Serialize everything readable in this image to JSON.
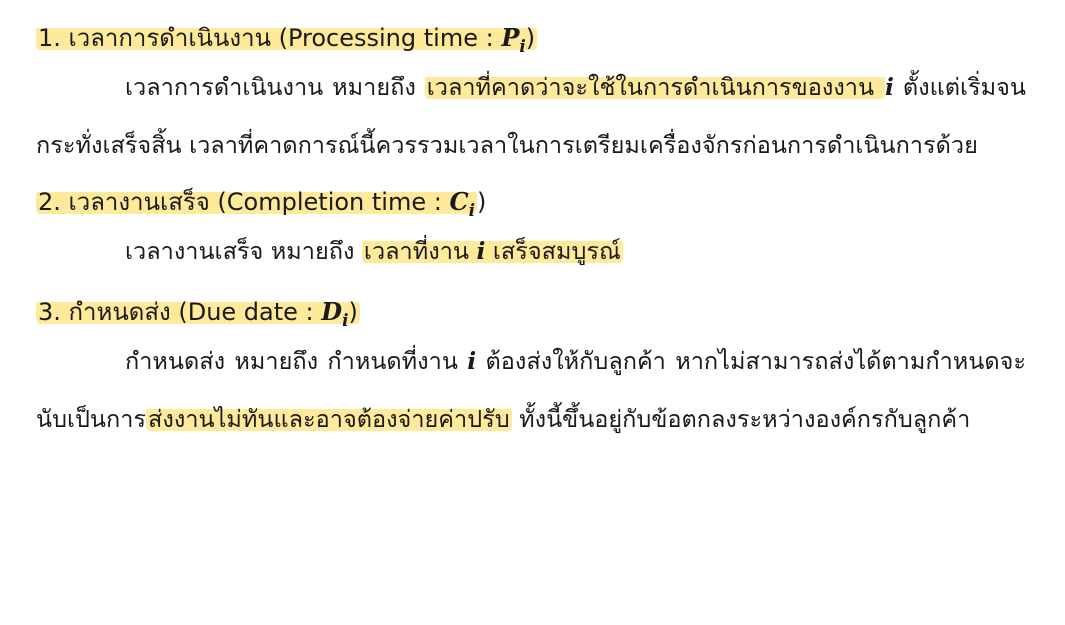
{
  "sections": [
    {
      "heading": {
        "prefix": "1. เวลาการดำเนินงาน (Processing time : ",
        "var": "P",
        "sub": "i",
        "suffix": ")"
      },
      "body": {
        "t1": "เวลาการดำเนินงาน หมายถึง ",
        "hl1": "เวลาที่คาดว่าจะใช้ในการดำเนินการของงาน ",
        "var": "i",
        "t2": " ตั้งแต่เริ่มจนกระทั่งเสร็จสิ้น เวลาที่คาดการณ์นี้ควรรวมเวลาในการเตรียมเครื่องจักรก่อนการดำเนินการด้วย"
      }
    },
    {
      "heading": {
        "prefix": "2. เวลางานเสร็จ (Completion time : ",
        "var": "C",
        "sub": "i",
        "suffix": ")"
      },
      "body": {
        "t1": "เวลางานเสร็จ หมายถึง ",
        "hl1": "เวลาที่งาน ",
        "var": "i",
        "hl2": " เสร็จสมบูรณ์"
      }
    },
    {
      "heading": {
        "prefix": "3. กำหนดส่ง (Due date : ",
        "var": "D",
        "sub": "i",
        "suffix": ")"
      },
      "body": {
        "t1": "กำหนดส่ง หมายถึง กำหนดที่งาน ",
        "var": "i",
        "t2": " ต้องส่งให้กับลูกค้า หากไม่สามารถส่งได้ตามกำหนดจะนับเป็นการ",
        "hl1": "ส่งงานไม่ทันและอาจต้องจ่ายค่าปรับ",
        "t3": " ทั้งนี้ขึ้นอยู่กับข้อตกลงระหว่างองค์กรกับลูกค้า"
      }
    }
  ],
  "colors": {
    "highlight": "#ffe278",
    "text": "#1a1a1a"
  }
}
